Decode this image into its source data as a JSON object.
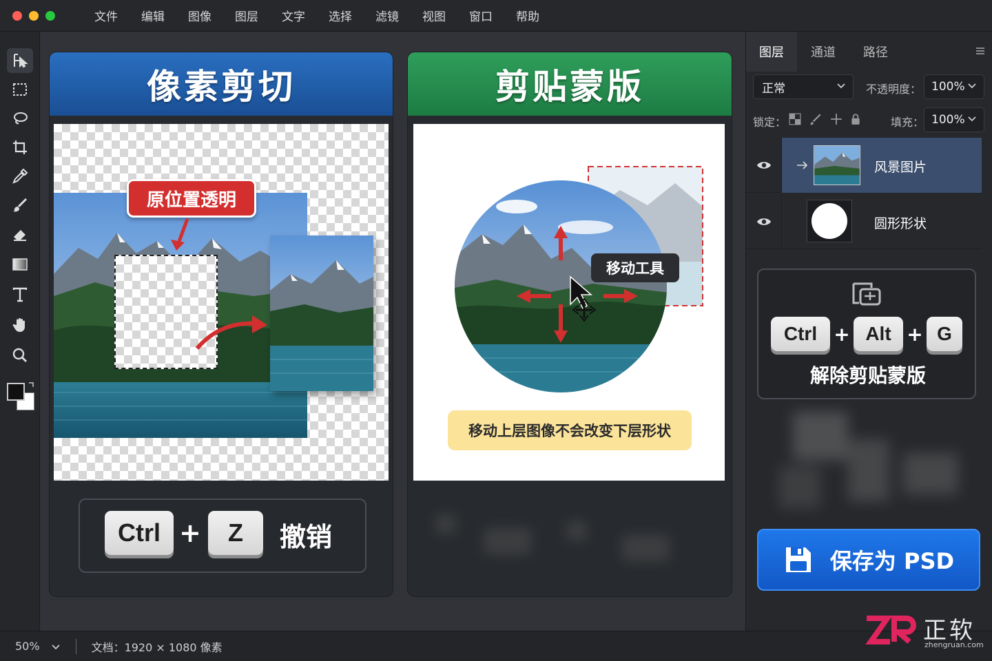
{
  "window": {
    "traffic_colors": [
      "#ff5f57",
      "#febc2e",
      "#28c840"
    ]
  },
  "menu": [
    "文件",
    "编辑",
    "图像",
    "图层",
    "文字",
    "选择",
    "滤镜",
    "视图",
    "窗口",
    "帮助"
  ],
  "tools": [
    "move-icon",
    "marquee-icon",
    "lasso-icon",
    "crop-icon",
    "eyedropper-icon",
    "brush-icon",
    "eraser-icon",
    "gradient-icon",
    "type-icon",
    "hand-icon",
    "zoom-icon",
    "color-swatch"
  ],
  "left_panel": {
    "title": "像素剪切",
    "callout": "原位置透明",
    "shortcut": {
      "key1": "Ctrl",
      "plus": "+",
      "key2": "Z",
      "action": "撤销"
    },
    "header_color": "#1f5ea8"
  },
  "right_card": {
    "title": "剪贴蒙版",
    "tool_tag": "移动工具",
    "note": "移动上层图像不会改变下层形状",
    "header_color": "#1f8a4c"
  },
  "layers_panel": {
    "tabs": [
      "图层",
      "通道",
      "路径"
    ],
    "blend_mode": "正常",
    "opacity_label": "不透明度：",
    "opacity_value": "100%",
    "lock_label": "锁定：",
    "fill_label": "填充：",
    "fill_value": "100%",
    "layers": [
      {
        "name": "风景图片",
        "visible": true,
        "clipped": true,
        "selected": true
      },
      {
        "name": "圆形形状",
        "visible": true,
        "clipped": false,
        "selected": false
      }
    ],
    "release_card": {
      "key1": "Ctrl",
      "plus1": "+",
      "key2": "Alt",
      "plus2": "+",
      "key3": "G",
      "action": "解除剪贴蒙版"
    },
    "save_button": "保存为 PSD",
    "accent": "#1565d8"
  },
  "status": {
    "zoom": "50%",
    "doc_info": "文档：1920 × 1080 像素"
  },
  "watermark": {
    "brand": "正软",
    "url": "zhengruan.com"
  }
}
